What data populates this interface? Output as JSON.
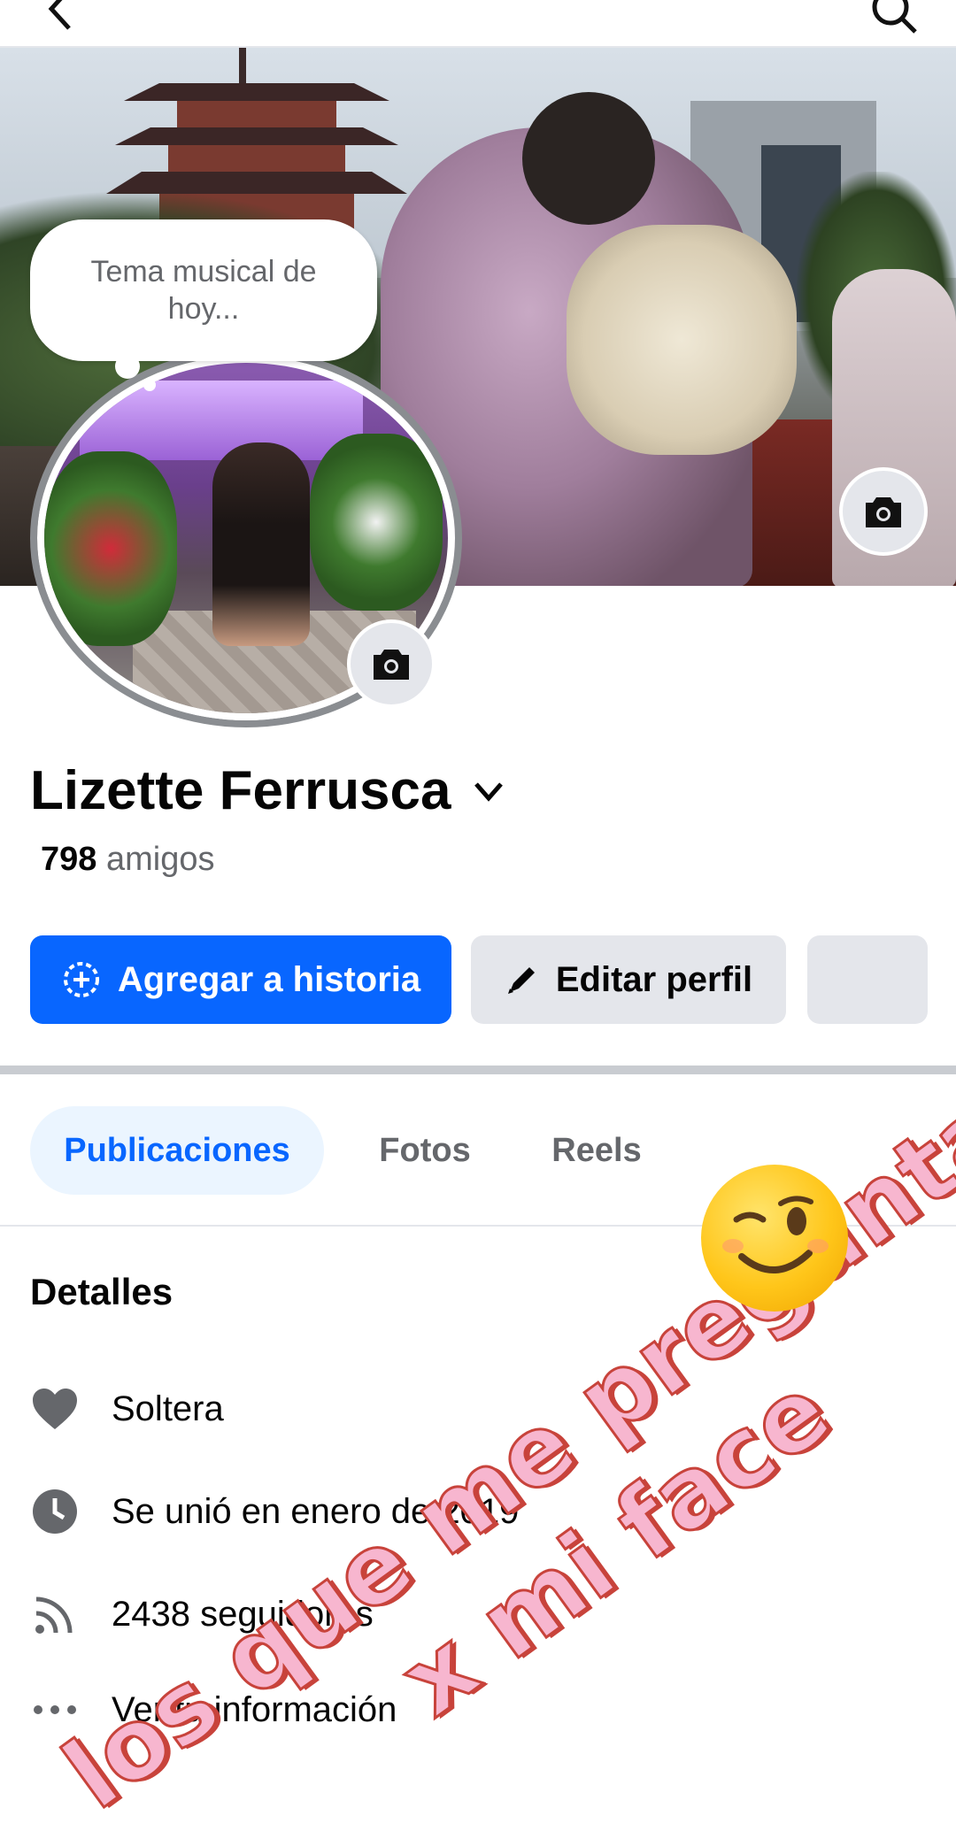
{
  "status": {
    "back_icon": "back-arrow-icon",
    "search_icon": "search-icon"
  },
  "profile": {
    "note_bubble": "Tema musical de hoy...",
    "name": "Lizette Ferrusca",
    "friends_count": "798",
    "friends_label": "amigos"
  },
  "actions": {
    "add_story": "Agregar a historia",
    "edit_profile": "Editar perfil"
  },
  "tabs": [
    {
      "label": "Publicaciones",
      "active": true
    },
    {
      "label": "Fotos",
      "active": false
    },
    {
      "label": "Reels",
      "active": false
    }
  ],
  "details": {
    "title": "Detalles",
    "relationship": "Soltera",
    "joined": "Se unió en enero de 2019",
    "followers": "2438 seguidores",
    "see_info": "Ver tu información"
  },
  "overlay": {
    "line1": "los que me preguntaron",
    "line2": "x mi face",
    "emoji": "winking-face"
  },
  "colors": {
    "primary": "#0866ff",
    "secondary_bg": "#e4e6eb",
    "active_tab_bg": "#ebf5ff",
    "sticker_fill": "#f7b6cf",
    "sticker_outline": "#c8433b"
  }
}
